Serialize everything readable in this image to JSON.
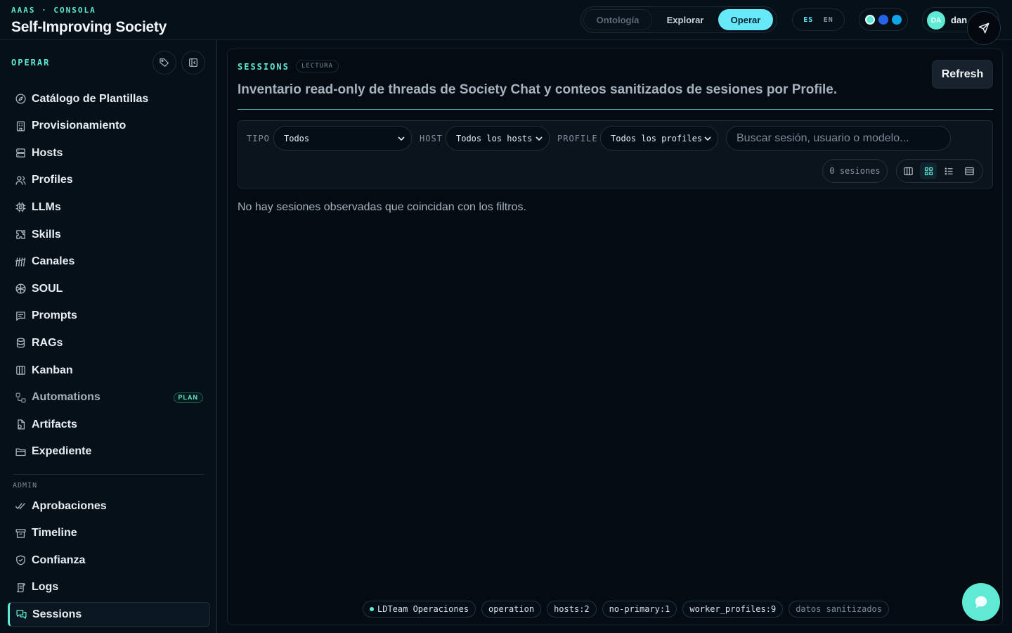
{
  "header": {
    "eyebrow": "AAAS · CONSOLA",
    "title": "Self-Improving Society",
    "modes": [
      "Ontología",
      "Explorar",
      "Operar"
    ],
    "active_mode": "Operar",
    "lang": {
      "es": "ES",
      "en": "EN",
      "active": "ES"
    },
    "theme_colors": [
      "#5eead4",
      "#2563eb",
      "#0ea5e9"
    ],
    "user": {
      "initials": "DA",
      "name": "dan"
    }
  },
  "sidebar": {
    "section": "OPERAR",
    "admin_label": "ADMIN",
    "items": [
      {
        "label": "Catálogo de Plantillas",
        "icon": "compass-icon"
      },
      {
        "label": "Provisionamiento",
        "icon": "building-icon"
      },
      {
        "label": "Hosts",
        "icon": "server-icon"
      },
      {
        "label": "Profiles",
        "icon": "users-icon"
      },
      {
        "label": "LLMs",
        "icon": "cpu-icon"
      },
      {
        "label": "Skills",
        "icon": "puzzle-icon"
      },
      {
        "label": "Canales",
        "icon": "antenna-icon"
      },
      {
        "label": "SOUL",
        "icon": "atom-icon"
      },
      {
        "label": "Prompts",
        "icon": "message-square-icon"
      },
      {
        "label": "RAGs",
        "icon": "database-icon"
      },
      {
        "label": "Kanban",
        "icon": "columns-icon"
      },
      {
        "label": "Automations",
        "icon": "workflow-icon",
        "badge": "PLAN"
      },
      {
        "label": "Artifacts",
        "icon": "file-icon"
      },
      {
        "label": "Expediente",
        "icon": "folder-icon"
      }
    ],
    "admin_items": [
      {
        "label": "Aprobaciones",
        "icon": "check-check-icon"
      },
      {
        "label": "Timeline",
        "icon": "archive-icon"
      },
      {
        "label": "Confianza",
        "icon": "shield-icon"
      },
      {
        "label": "Logs",
        "icon": "scroll-icon"
      },
      {
        "label": "Sessions",
        "icon": "messages-icon"
      }
    ],
    "active_item": "Sessions"
  },
  "main": {
    "section": "SESSIONS",
    "badge": "LECTURA",
    "refresh_label": "Refresh",
    "description": "Inventario read-only de threads de Society Chat y conteos sanitizados de sesiones por Profile.",
    "filters": {
      "tipo_label": "TIPO",
      "tipo_value": "Todos",
      "host_label": "HOST",
      "host_value": "Todos los hosts",
      "profile_label": "PROFILE",
      "profile_value": "Todos los profiles",
      "search_placeholder": "Buscar sesión, usuario o modelo...",
      "count": "0 sesiones"
    },
    "empty_message": "No hay sesiones observadas que coincidan con los filtros.",
    "footer_chips": [
      "LDTeam Operaciones",
      "operation",
      "hosts:2",
      "no-primary:1",
      "worker_profiles:9",
      "datos sanitizados"
    ]
  }
}
